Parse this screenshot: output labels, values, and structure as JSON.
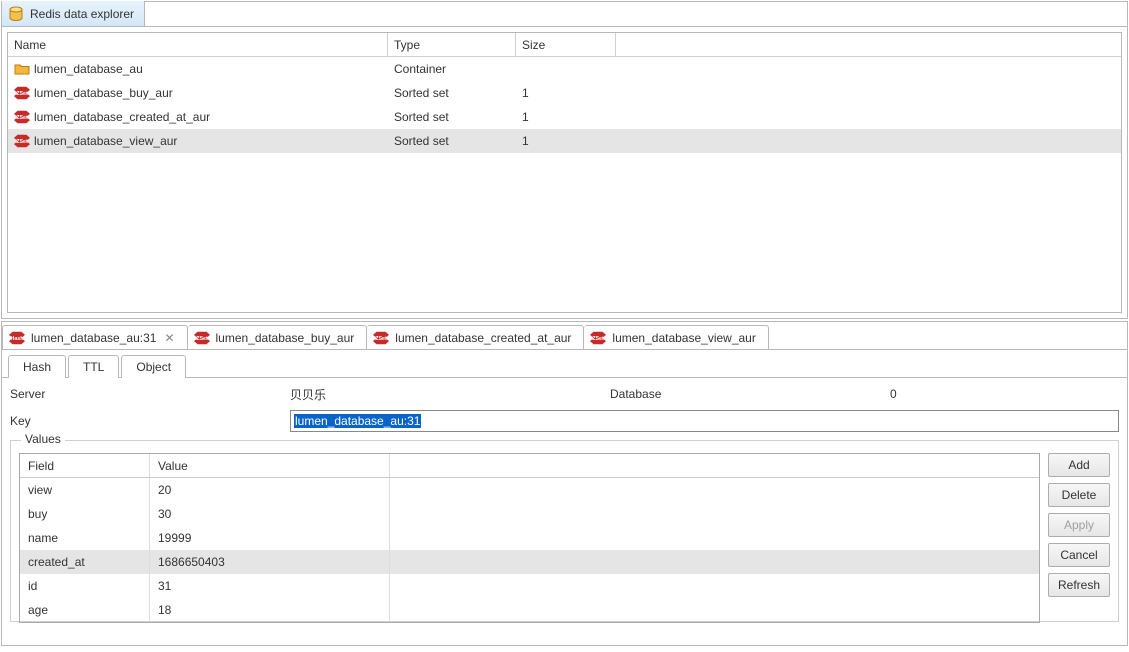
{
  "tab_title": "Redis data explorer",
  "tree": {
    "headers": {
      "name": "Name",
      "type": "Type",
      "size": "Size"
    },
    "rows": [
      {
        "icon": "folder",
        "name": "lumen_database_au",
        "type": "Container",
        "size": "",
        "selected": false
      },
      {
        "icon": "zset",
        "name": "lumen_database_buy_aur",
        "type": "Sorted set",
        "size": "1",
        "selected": false
      },
      {
        "icon": "zset",
        "name": "lumen_database_created_at_aur",
        "type": "Sorted set",
        "size": "1",
        "selected": false
      },
      {
        "icon": "zset",
        "name": "lumen_database_view_aur",
        "type": "Sorted set",
        "size": "1",
        "selected": true
      }
    ]
  },
  "bottom_tabs": [
    {
      "icon": "hash",
      "label": "lumen_database_au:31",
      "closable": true,
      "active": true
    },
    {
      "icon": "zset",
      "label": "lumen_database_buy_aur",
      "closable": false,
      "active": false
    },
    {
      "icon": "zset",
      "label": "lumen_database_created_at_aur",
      "closable": false,
      "active": false
    },
    {
      "icon": "zset",
      "label": "lumen_database_view_aur",
      "closable": false,
      "active": false
    }
  ],
  "sub_tabs": {
    "hash": "Hash",
    "ttl": "TTL",
    "object": "Object"
  },
  "info": {
    "server_label": "Server",
    "server_value": "贝贝乐",
    "database_label": "Database",
    "database_value": "0",
    "key_label": "Key",
    "key_value": "lumen_database_au:31"
  },
  "values_legend": "Values",
  "values_table": {
    "headers": {
      "field": "Field",
      "value": "Value"
    },
    "rows": [
      {
        "field": "view",
        "value": "20",
        "selected": false
      },
      {
        "field": "buy",
        "value": "30",
        "selected": false
      },
      {
        "field": "name",
        "value": "19999",
        "selected": false
      },
      {
        "field": "created_at",
        "value": "1686650403",
        "selected": true
      },
      {
        "field": "id",
        "value": "31",
        "selected": false
      },
      {
        "field": "age",
        "value": "18",
        "selected": false
      }
    ]
  },
  "buttons": {
    "add": "Add",
    "delete": "Delete",
    "apply": "Apply",
    "cancel": "Cancel",
    "refresh": "Refresh"
  }
}
